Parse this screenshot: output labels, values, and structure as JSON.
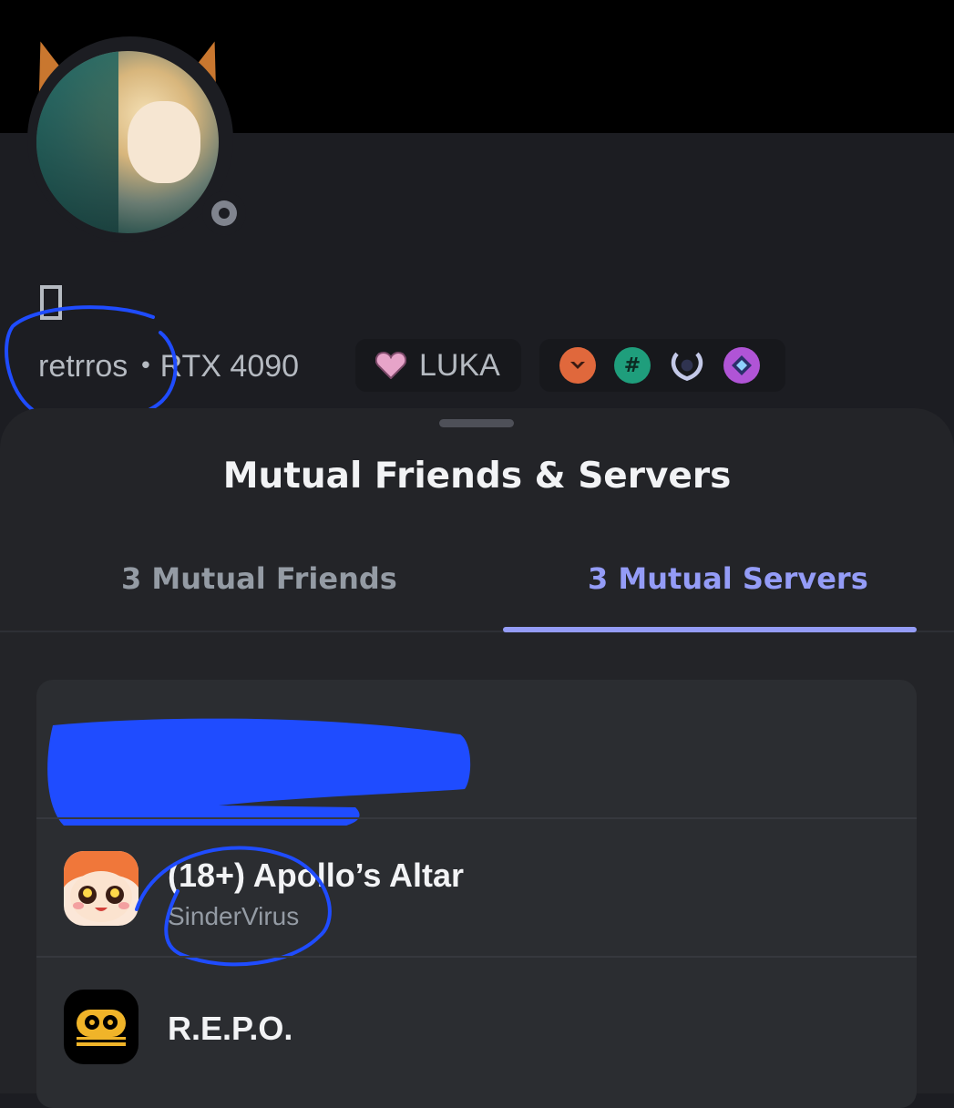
{
  "profile": {
    "username": "retrros",
    "separator": "•",
    "tag_text": "RTX 4090",
    "glyph": "▯",
    "clan": {
      "name": "LUKA",
      "icon": "pink-heart-icon"
    },
    "badges": [
      "hypesquad-bravery-icon",
      "hashtag-quest-icon",
      "laurel-icon",
      "nitro-diamond-icon"
    ],
    "status": "invisible"
  },
  "sheet": {
    "title": "Mutual Friends & Servers",
    "tabs": [
      {
        "label": "3 Mutual Friends",
        "active": false
      },
      {
        "label": "3 Mutual Servers",
        "active": true
      }
    ]
  },
  "servers": [
    {
      "name": "",
      "nickname": "",
      "redacted": true
    },
    {
      "name": "(18+) Apollo’s Altar",
      "nickname": "SinderVirus",
      "icon": "anime-character-icon"
    },
    {
      "name": "R.E.P.O.",
      "nickname": "",
      "icon": "repo-robot-icon"
    }
  ],
  "colors": {
    "accent": "#949cf7",
    "annotation_blue": "#1f4cff",
    "sheet_bg": "#232428",
    "card_bg": "#2b2d31"
  }
}
